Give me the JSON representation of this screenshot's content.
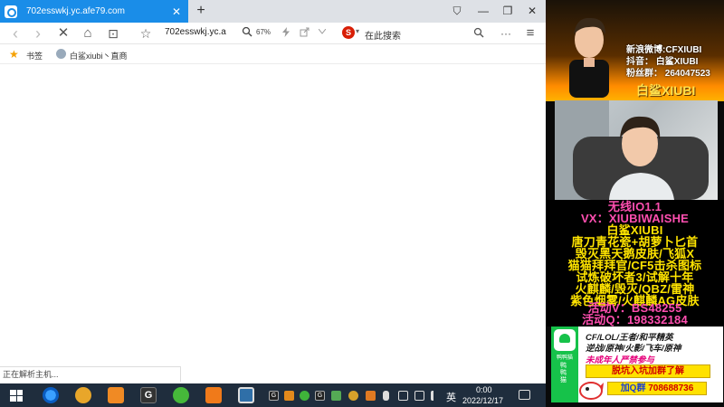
{
  "browser": {
    "tab": {
      "title": "702esswkj.yc.afe79.com",
      "close": "✕"
    },
    "new_tab": "+",
    "window_controls": {
      "pin": "⛉",
      "minimize": "—",
      "restore": "❐",
      "close": "✕"
    },
    "nav": {
      "back": "‹",
      "forward": "›",
      "stop": "✕",
      "home": "⌂",
      "reader": "⊡",
      "favorite": "☆",
      "url": "702esswkj.yc.a",
      "zoom": "67%",
      "search_engine_glyph": "S",
      "search_placeholder": "在此搜索",
      "menu": "···",
      "hamburger": "≡",
      "lens": "⌕"
    },
    "bookmarks": {
      "label": "书签",
      "items": [
        "白鲨xiubi丶直商"
      ]
    },
    "status": "正在解析主机..."
  },
  "taskbar": {
    "input_method": "英",
    "time": "0:00",
    "date": "2022/12/17",
    "small_icon_g": "G",
    "small_icon_g2": "G"
  },
  "overlay": {
    "social": [
      "新浪微博:CFXIUBI",
      "抖音：  白鲨XIUBI",
      "粉丝群：  264047523"
    ],
    "name": "白鲨XIUBI",
    "promo": [
      {
        "text": "无线IO1.1",
        "color": "pink"
      },
      {
        "text": "VX：XIUBIWAISHE",
        "color": "pink"
      },
      {
        "text": "白鲨XIUBI",
        "color": "yellow"
      },
      {
        "text": "唐刀青花瓷+胡萝卜匕首",
        "color": "yellow"
      },
      {
        "text": "毁灭黑天鹅皮肤/飞狐X",
        "color": "yellow"
      },
      {
        "text": "猫猫拜拜官/CF5击杀图标",
        "color": "yellow"
      },
      {
        "text": "试炼破坏者3/试解十年",
        "color": "yellow"
      },
      {
        "text": "火麒麟/毁灭/QBZ/雷神",
        "color": "yellow"
      },
      {
        "text": "紫色烟雾/火麒麟AG皮肤",
        "color": "yellow"
      },
      {
        "text": "活动V：BS48255",
        "color": "pink"
      },
      {
        "text": "活动Q：198332184",
        "color": "pink"
      }
    ],
    "ad": {
      "brand": "鸭鸭猫",
      "vertical": "鸭鸭猫",
      "line1": "CF/LOL/王者/和平精英",
      "line2": "逆战/原神/火影/飞车/原神",
      "line3": "未成年人严禁参与",
      "cta": "脱坑入坑加群了解",
      "q_label": "加Q群",
      "q_number": "708688736"
    }
  },
  "colors": {
    "tab_blue": "#1a8de8",
    "promo_pink": "#ff4fb0",
    "promo_yellow": "#ffe400",
    "ad_green": "#16c24a"
  }
}
